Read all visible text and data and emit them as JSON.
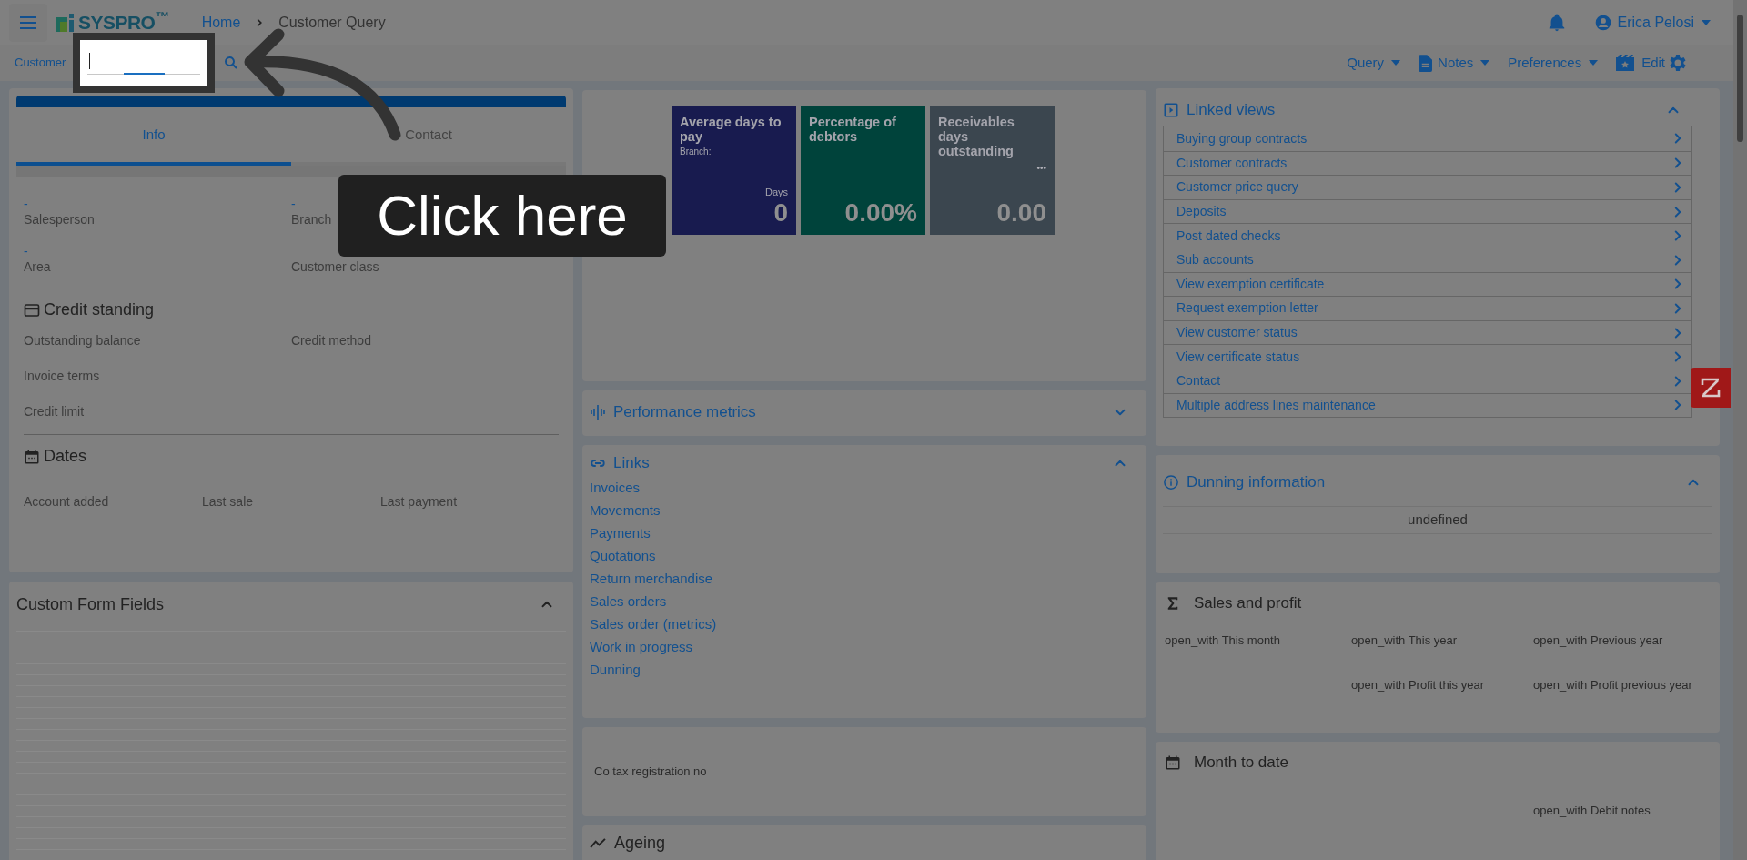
{
  "header": {
    "logo": "SYSPRO$^{™}$",
    "breadcrumb": [
      {
        "label": "Home",
        "kind": "link"
      },
      {
        "label": "Customer Query",
        "kind": "current"
      }
    ],
    "user": "Erica Pelosi"
  },
  "toolbar": {
    "customer_label": "Customer",
    "menus": [
      {
        "label": "Query",
        "kind": "dropdown"
      },
      {
        "label": "Notes",
        "kind": "dropdown"
      },
      {
        "label": "Preferences",
        "kind": "dropdown"
      },
      {
        "label": "Edit",
        "kind": "button"
      }
    ]
  },
  "info_card": {
    "tabs": [
      {
        "label": "Info",
        "selected": true
      },
      {
        "label": "Contact",
        "selected": false
      }
    ],
    "fields": [
      {
        "value": "-",
        "label": "Salesperson"
      },
      {
        "value": "-",
        "label": "Branch"
      },
      {
        "value": "-",
        "label": "Area"
      },
      {
        "label": "Customer class"
      }
    ],
    "credit_standing": {
      "title": "Credit standing",
      "fields": [
        "Outstanding balance",
        "Credit method",
        "Invoice terms",
        "Credit limit"
      ]
    },
    "dates": {
      "title": "Dates",
      "fields": [
        "Account added",
        "Last sale",
        "Last payment"
      ]
    }
  },
  "custom_form_fields": {
    "title": "Custom Form Fields",
    "expanded": true
  },
  "kpi_tiles": [
    {
      "title": "Average days to pay",
      "subtitle": "Branch:",
      "unit": "Days",
      "value": "0",
      "color": "#181b4f"
    },
    {
      "title": "Percentage of debtors",
      "value": "0.00%",
      "color": "#00433b"
    },
    {
      "title": "Receivables days outstanding",
      "more": "•••",
      "value": "0.00",
      "color": "#3b464f"
    }
  ],
  "performance_metrics": {
    "title": "Performance metrics",
    "expanded": false
  },
  "links": {
    "title": "Links",
    "expanded": true,
    "items": [
      "Invoices",
      "Movements",
      "Payments",
      "Quotations",
      "Return merchandise",
      "Sales orders",
      "Sales order (metrics)",
      "Work in progress",
      "Dunning"
    ]
  },
  "tax": {
    "label": "Co tax registration no"
  },
  "ageing": {
    "title": "Ageing"
  },
  "linked_views": {
    "title": "Linked views",
    "expanded": true,
    "items": [
      "Buying group contracts",
      "Customer contracts",
      "Customer price query",
      "Deposits",
      "Post dated checks",
      "Sub accounts",
      "View exemption certificate",
      "Request exemption letter",
      "View customer status",
      "View certificate status",
      "Contact",
      "Multiple address lines maintenance"
    ]
  },
  "dunning": {
    "title": "Dunning information",
    "expanded": true,
    "value": "undefined"
  },
  "sales_and_profit": {
    "title": "Sales and profit",
    "rows": [
      [
        "open_with This month",
        "open_with This year",
        "open_with Previous year"
      ],
      [
        null,
        "open_with Profit this year",
        "open_with Profit previous year"
      ]
    ]
  },
  "month_to_date": {
    "title": "Month to date",
    "rows": [
      [
        null,
        null,
        "open_with Debit notes"
      ]
    ]
  },
  "tutorial": {
    "callout": "Click here"
  }
}
